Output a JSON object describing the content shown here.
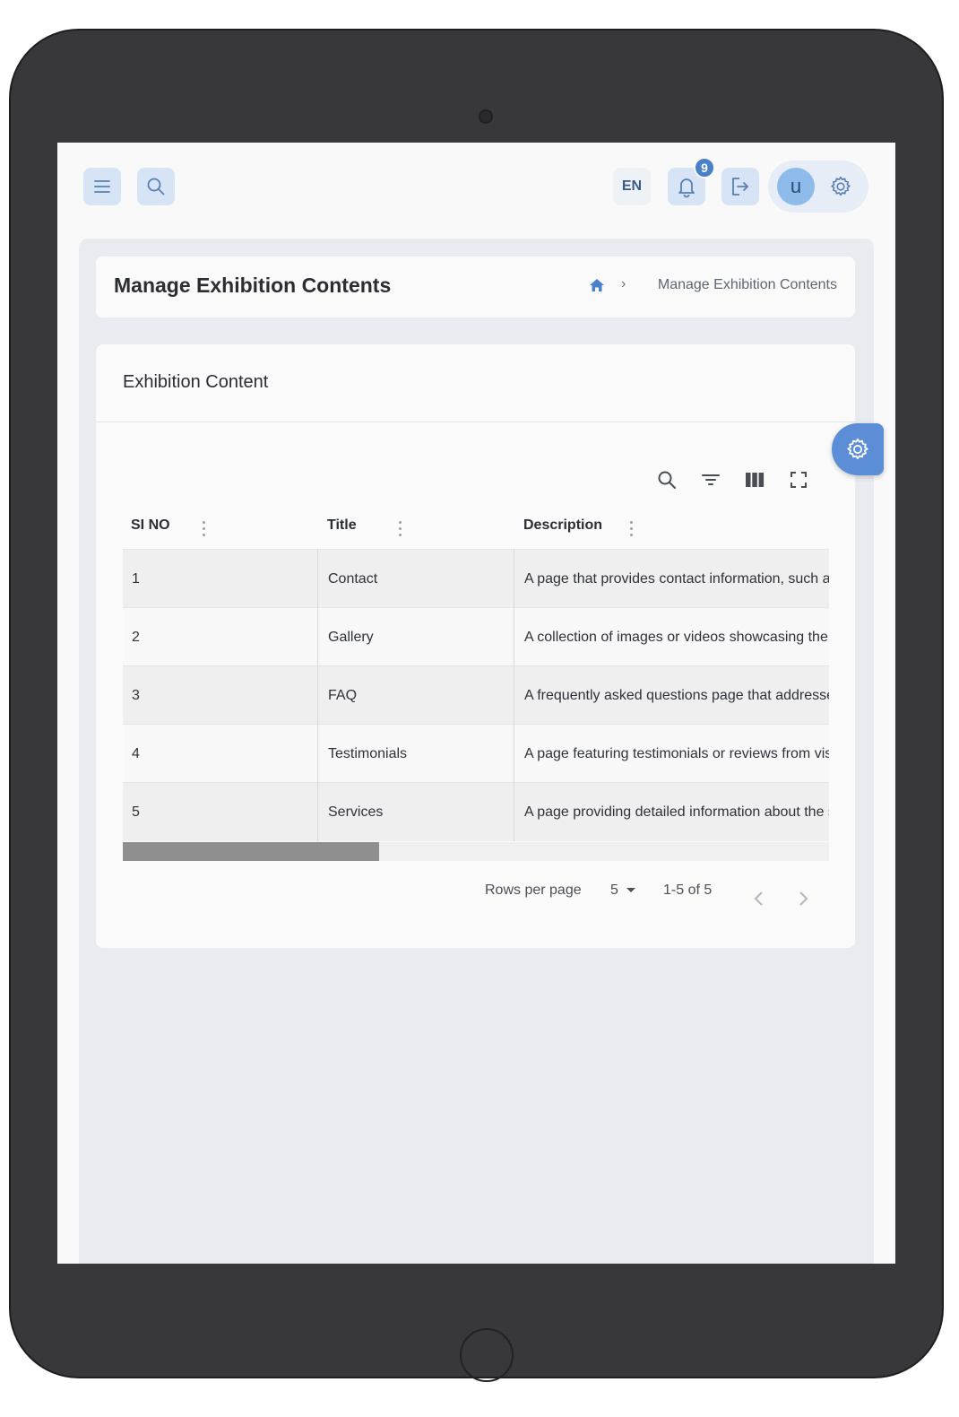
{
  "header": {
    "language_label": "EN",
    "notification_count": "9",
    "avatar_initial": "u"
  },
  "page": {
    "title": "Manage Exhibition Contents",
    "breadcrumb_current": "Manage Exhibition Contents"
  },
  "section": {
    "title": "Exhibition Content"
  },
  "table": {
    "columns": [
      "SI NO",
      "Title",
      "Description"
    ],
    "rows": [
      {
        "si_no": "1",
        "title": "Contact",
        "description": "A page that provides contact information, such as address, phone number and email"
      },
      {
        "si_no": "2",
        "title": "Gallery",
        "description": "A collection of images or videos showcasing the exhibition"
      },
      {
        "si_no": "3",
        "title": "FAQ",
        "description": "A frequently asked questions page that addresses common queries"
      },
      {
        "si_no": "4",
        "title": "Testimonials",
        "description": "A page featuring testimonials or reviews from visitors"
      },
      {
        "si_no": "5",
        "title": "Services",
        "description": "A page providing detailed information about the services offered"
      }
    ]
  },
  "pagination": {
    "rows_per_page_label": "Rows per page",
    "rows_per_page_value": "5",
    "range_text": "1-5 of 5"
  },
  "icons": {
    "menu": "menu-icon",
    "search": "search-icon",
    "bell": "bell-icon",
    "logout": "logout-icon",
    "settings": "gear-icon",
    "home": "home-icon",
    "filter": "filter-icon",
    "columns": "columns-icon",
    "fullscreen": "fullscreen-icon"
  },
  "colors": {
    "accent": "#5b8ed6",
    "button_bg": "#d6e4f6",
    "badge": "#4a7fc9"
  }
}
